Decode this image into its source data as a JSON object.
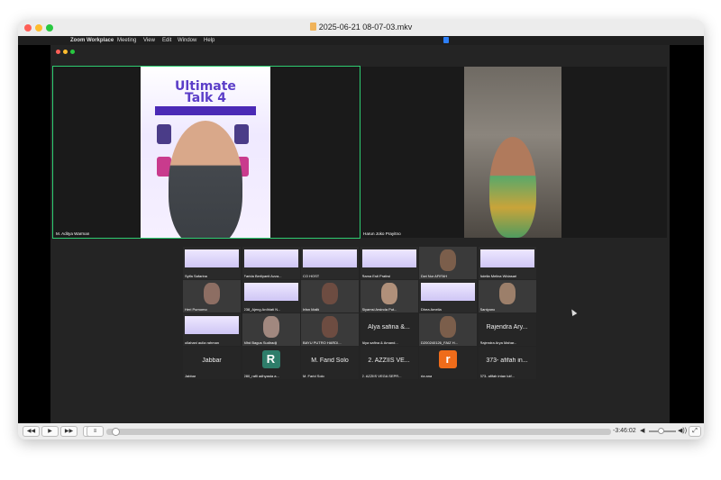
{
  "window": {
    "title": "2025-06-21 08-07-03.mkv"
  },
  "menubar": {
    "app": "Zoom Workplace",
    "items": [
      "Meeting",
      "View",
      "Edit",
      "Window",
      "Help"
    ]
  },
  "speakers": [
    {
      "name": "M. Aditya Warman"
    },
    {
      "name": "Harun Joko Prayitno"
    }
  ],
  "poster": {
    "title_line1": "Ultimate",
    "title_line2": "Talk 4"
  },
  "gallery": [
    {
      "name": "Syifa Safarina",
      "kind": "poster"
    },
    {
      "name": "Farida Berliyanti Azza...",
      "kind": "poster"
    },
    {
      "name": "CO HOST",
      "kind": "poster"
    },
    {
      "name": "Rama Esti Pratiwi",
      "kind": "poster"
    },
    {
      "name": "Dwi Nur AFIFAH",
      "kind": "face"
    },
    {
      "name": "Adella Melina Widasari",
      "kind": "poster"
    },
    {
      "name": "Heri Purnomo",
      "kind": "face"
    },
    {
      "name": "238_Ajeng Ardhiati N...",
      "kind": "poster"
    },
    {
      "name": "Irfan Malik",
      "kind": "face"
    },
    {
      "name": "Siyamsi Arsinda Put...",
      "kind": "face"
    },
    {
      "name": "Dhea Amelia",
      "kind": "poster"
    },
    {
      "name": "Santyono",
      "kind": "face"
    },
    {
      "name": "ollahani aulia rahman",
      "kind": "poster"
    },
    {
      "name": "Mhd Bagus Sudiradji",
      "kind": "face"
    },
    {
      "name": "BAYU PUTRO HARDI...",
      "kind": "face"
    },
    {
      "name": "Alya safina & Amand...",
      "kind": "text",
      "big": "Alya safina &..."
    },
    {
      "name": "D200240126_FAIZ H...",
      "kind": "face"
    },
    {
      "name": "Rajendra Arya Mahar...",
      "kind": "text",
      "big": "Rajendra Ary..."
    },
    {
      "name": "Jabbar",
      "kind": "text",
      "big": "Jabbar"
    },
    {
      "name": "280_rafli adhyasta a...",
      "kind": "letter",
      "letter": "R"
    },
    {
      "name": "M. Farid Solo",
      "kind": "text",
      "big": "M. Farid Solo"
    },
    {
      "name": "2. AZZIIS VEGA SEPR...",
      "kind": "text",
      "big": "2. AZZIIS VE..."
    },
    {
      "name": "ria ana",
      "kind": "letter",
      "letter": "r"
    },
    {
      "name": "373- afifah intan lutf...",
      "kind": "text",
      "big": "373- afifah in..."
    }
  ],
  "colors": {
    "letter_R": "#2e7d6a",
    "letter_r": "#ef6c1a"
  },
  "controls": {
    "rewind": "◀◀",
    "play": "▶",
    "forward": "▶▶",
    "stop": "■",
    "playlist": "≡",
    "time": "-3:46:02",
    "volume_low": "◀",
    "volume_high": "◀))",
    "fullscreen": "⤢"
  },
  "playback": {
    "progress": 0.01,
    "volume": 0.4
  }
}
